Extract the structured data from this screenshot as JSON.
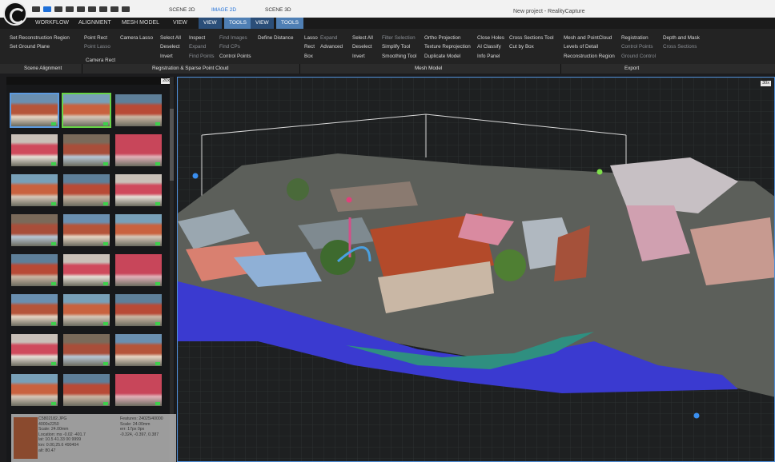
{
  "title_bar": {
    "tabs": [
      "SCENE 2D",
      "IMAGE 2D",
      "SCENE 3D"
    ],
    "app_title": "New project - RealityCapture"
  },
  "menu": {
    "items": [
      "WORKFLOW",
      "ALIGNMENT",
      "MESH MODEL",
      "VIEW"
    ],
    "sub_tabs": [
      "VIEW",
      "TOOLS",
      "VIEW",
      "TOOLS"
    ]
  },
  "ribbon": {
    "alignment": {
      "col1": [
        "Set Reconstruction Region",
        "Set Ground Plane"
      ],
      "col2": [
        "Point Rect",
        "Point Lasso"
      ],
      "col3": [
        "Camera Lasso",
        "Camera Rect"
      ],
      "col4": [
        "Select All",
        "Deselect",
        "Invert"
      ],
      "col5": [
        "Inspect",
        "Expand",
        "Find Points"
      ],
      "col6": [
        "Find Images",
        "Find CPs",
        "Control Points"
      ],
      "col7": [
        "Define Distance"
      ]
    },
    "mesh": {
      "col1": [
        "Lasso",
        "Rect",
        "Box"
      ],
      "col2": [
        "Expand",
        "Advanced"
      ],
      "col3": [
        "Select All",
        "Deselect",
        "Invert"
      ],
      "col4": [
        "Filter Selection",
        "Simplify Tool",
        "Smoothing Tool"
      ],
      "col5": [
        "Ortho Projection",
        "Texture Reprojection",
        "Duplicate Model"
      ],
      "col6": [
        "Close Holes",
        "AI Classify",
        "Info Panel"
      ],
      "col7": [
        "Cross Sections Tool",
        "Cut by Box"
      ]
    },
    "export": {
      "col1": [
        "Mesh and PointCloud",
        "Levels of Detail",
        "Reconstruction Region"
      ],
      "col2": [
        "Registration",
        "Control Points",
        "Ground Control"
      ],
      "col3": [
        "Depth and Mask",
        "Cross Sections"
      ]
    },
    "groups": [
      "Scene Alignment",
      "Registration & Sparse Point Cloud",
      "Mesh Model",
      "Export"
    ]
  },
  "panel": {
    "badge": "20x",
    "info": {
      "col1": [
        "C5802182.JPG",
        "4000x2250",
        "Scale: 24.00mm",
        "Location: ms -0.02 -401.7",
        "lat: 10.5 41.33 00 9999",
        "lon: 0.00,25.6 490404",
        "alt: 80.47"
      ],
      "col2": [
        "Features: 24025/40000",
        "Scale: 24.00mm",
        "err: 17px 0px",
        "-0.324, -0.397, 0.387"
      ]
    }
  },
  "viewport": {
    "badge": "30x"
  },
  "colors": {
    "accent": "#4e8ed8",
    "select_green": "#67d446",
    "menu_bg": "#1a1a1a"
  }
}
